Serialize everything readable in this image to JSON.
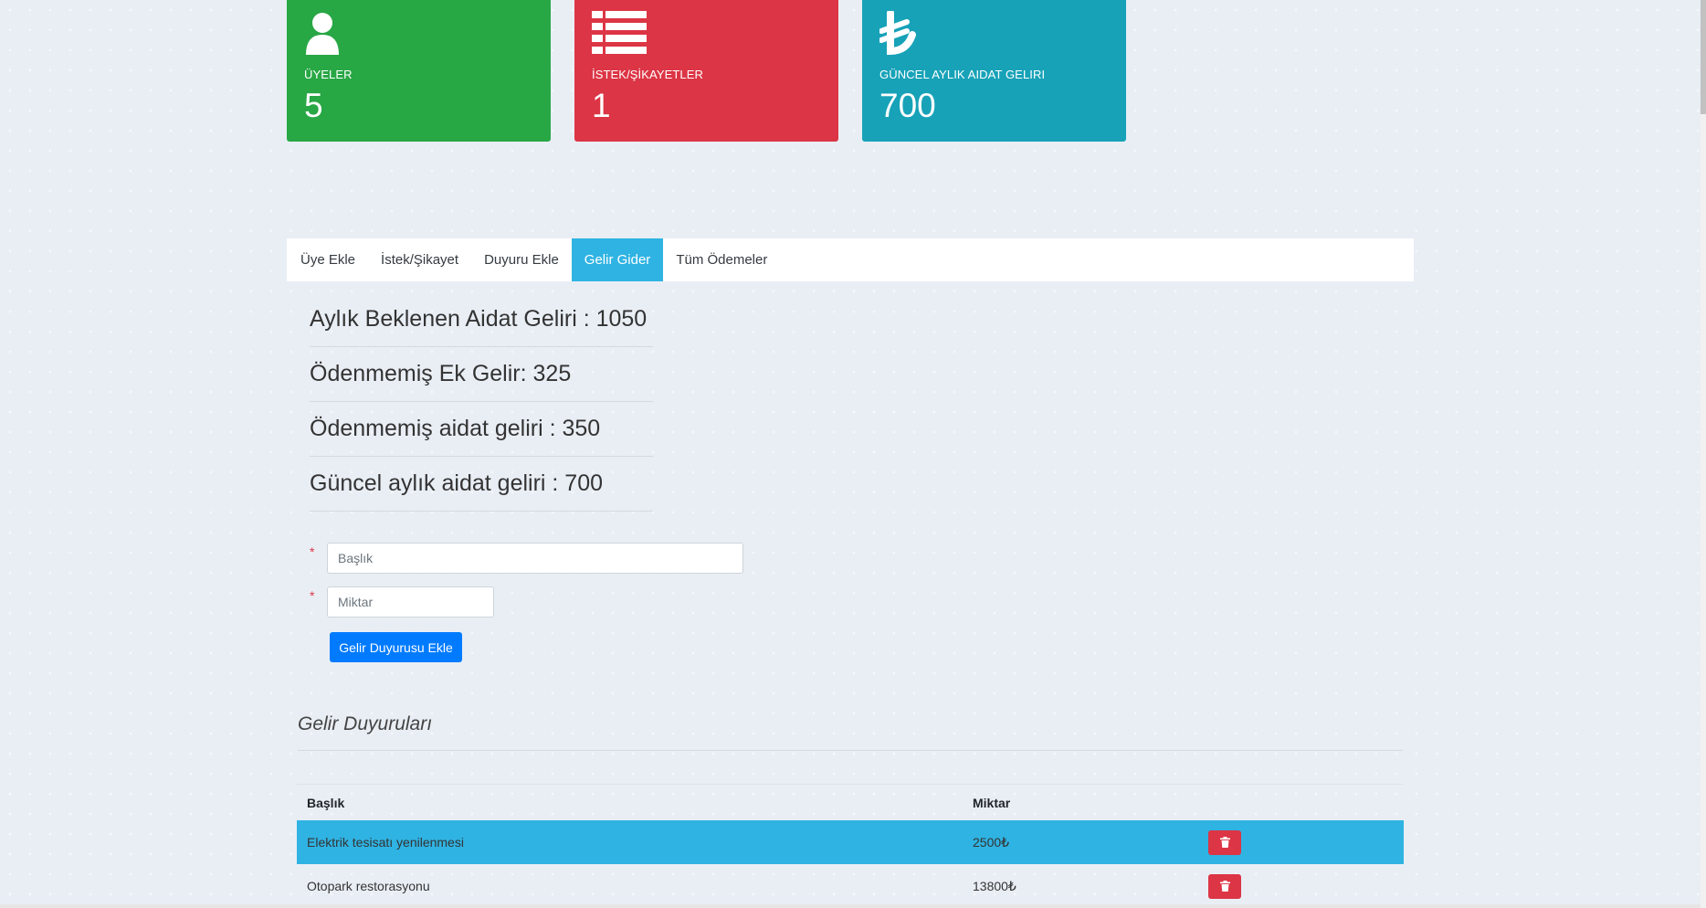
{
  "stats": [
    {
      "label": "ÜYELER",
      "value": "5",
      "icon": "user-icon",
      "color": "#28a745"
    },
    {
      "label": "İSTEK/ŞİKAYETLER",
      "value": "1",
      "icon": "list-icon",
      "color": "#dc3545"
    },
    {
      "label": "GÜNCEL AYLIK AIDAT GELIRI",
      "value": "700",
      "icon": "lira-icon",
      "color": "#17a2b8"
    }
  ],
  "tabs": [
    "Üye Ekle",
    "İstek/Şikayet",
    "Duyuru Ekle",
    "Gelir Gider",
    "Tüm Ödemeler"
  ],
  "active_tab": "Gelir Gider",
  "summary": [
    "Aylık Beklenen Aidat Geliri : 1050",
    "Ödenmemiş Ek Gelir: 325",
    "Ödenmemiş aidat geliri : 350",
    "Güncel aylık aidat geliri : 700"
  ],
  "form": {
    "required_mark": "*",
    "title_placeholder": "Başlık",
    "amount_placeholder": "Miktar",
    "submit_label": "Gelir Duyurusu Ekle"
  },
  "section_title": "Gelir Duyuruları",
  "table": {
    "headers": [
      "Başlık",
      "Miktar"
    ],
    "rows": [
      {
        "title": "Elektrik tesisatı yenilenmesi",
        "amount": "2500₺"
      },
      {
        "title": "Otopark restorasyonu",
        "amount": "13800₺"
      }
    ]
  },
  "colors": {
    "tab_active": "#2fb3e3",
    "primary": "#007bff",
    "danger": "#dc3545"
  }
}
